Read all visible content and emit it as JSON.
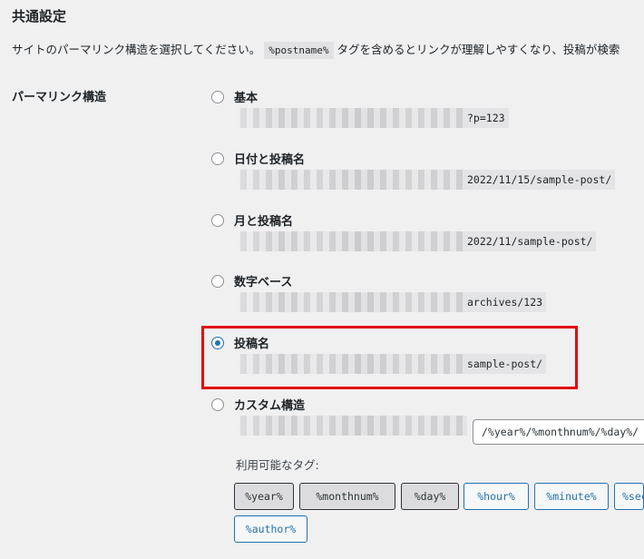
{
  "section": {
    "title": "共通設定"
  },
  "intro": {
    "before": "サイトのパーマリンク構造を選択してください。",
    "code": "%postname%",
    "after": "タグを含めるとリンクが理解しやすくなり、投稿が検索"
  },
  "permalink": {
    "row_label": "パーマリンク構造",
    "options": [
      {
        "label": "基本",
        "url_suffix": "?p=123",
        "checked": false
      },
      {
        "label": "日付と投稿名",
        "url_suffix": "2022/11/15/sample-post/",
        "checked": false
      },
      {
        "label": "月と投稿名",
        "url_suffix": "2022/11/sample-post/",
        "checked": false
      },
      {
        "label": "数字ベース",
        "url_suffix": "archives/123",
        "checked": false
      },
      {
        "label": "投稿名",
        "url_suffix": "sample-post/",
        "checked": true
      },
      {
        "label": "カスタム構造",
        "checked": false
      }
    ],
    "custom_value": "/%year%/%monthnum%/%day%/"
  },
  "tags": {
    "label": "利用可能なタグ:",
    "items": [
      {
        "text": "%year%",
        "active": true
      },
      {
        "text": "%monthnum%",
        "active": true
      },
      {
        "text": "%day%",
        "active": true
      },
      {
        "text": "%hour%",
        "active": false
      },
      {
        "text": "%minute%",
        "active": false
      },
      {
        "text": "%second%",
        "active": false
      },
      {
        "text": "%author%",
        "active": false
      }
    ]
  },
  "colors": {
    "accent": "#2271b1",
    "highlight": "#e20a0a"
  }
}
